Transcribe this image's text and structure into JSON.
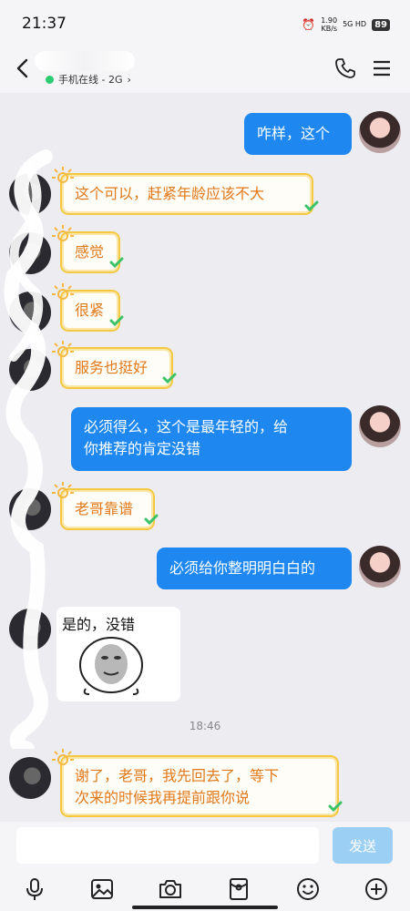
{
  "status_bar": {
    "time": "21:37",
    "speed_value": "1.90",
    "speed_unit": "KB/s",
    "network": "5G HD",
    "battery": "89"
  },
  "header": {
    "presence": "手机在线 - 2G",
    "presence_chevron": "›"
  },
  "messages": [
    {
      "side": "me",
      "text": "咋样，这个"
    },
    {
      "side": "other",
      "text": "这个可以，赶紧年龄应该不大"
    },
    {
      "side": "other",
      "text": "感觉"
    },
    {
      "side": "other",
      "text": "很紧"
    },
    {
      "side": "other",
      "text": "服务也挺好"
    },
    {
      "side": "me",
      "text_line1": "必须得么，这个是最年轻的，给",
      "text_line2": "你推荐的肯定没错"
    },
    {
      "side": "other",
      "text": "老哥靠谱"
    },
    {
      "side": "me",
      "text": "必须给你整明明白白的"
    },
    {
      "side": "other",
      "type": "sticker",
      "text": "是的，没错"
    },
    {
      "type": "timestamp",
      "text": "18:46"
    },
    {
      "side": "other",
      "text_line1": "谢了，老哥，我先回去了，等下",
      "text_line2": "次来的时候我再提前跟你说"
    }
  ],
  "input": {
    "placeholder": "",
    "send_label": "发送"
  },
  "toolbar": [
    "mic-icon",
    "image-icon",
    "camera-icon",
    "red-packet-icon",
    "emoji-icon",
    "plus-icon"
  ],
  "colors": {
    "me_bubble": "#1e88f0",
    "other_text": "#e0791b",
    "other_border": "#f5c842",
    "send_button": "#9ccff4"
  }
}
